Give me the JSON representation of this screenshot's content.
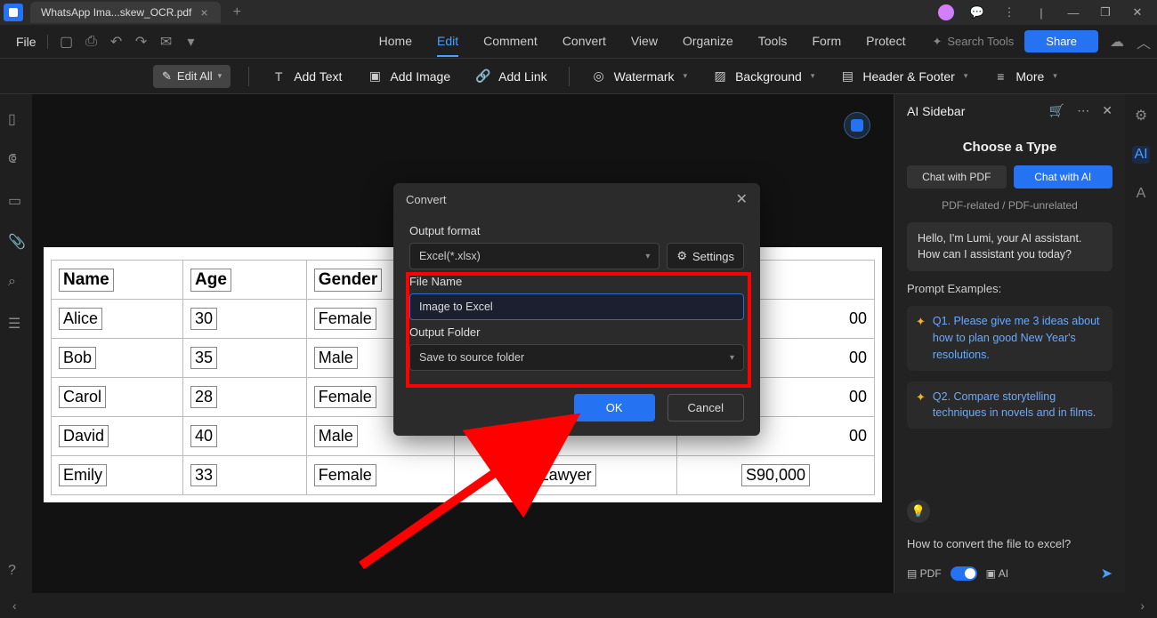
{
  "titlebar": {
    "tab_title": "WhatsApp Ima...skew_OCR.pdf"
  },
  "menubar": {
    "file": "File",
    "tabs": [
      "Home",
      "Edit",
      "Comment",
      "Convert",
      "View",
      "Organize",
      "Tools",
      "Form",
      "Protect"
    ],
    "active_tab_index": 1,
    "search_placeholder": "Search Tools",
    "share": "Share"
  },
  "toolbar": {
    "edit_all": "Edit All",
    "add_text": "Add Text",
    "add_image": "Add Image",
    "add_link": "Add Link",
    "watermark": "Watermark",
    "background": "Background",
    "header_footer": "Header & Footer",
    "more": "More"
  },
  "document": {
    "headers": [
      "Name",
      "Age",
      "Gender",
      "",
      ""
    ],
    "rows": [
      [
        "Alice",
        "30",
        "Female",
        "",
        "00"
      ],
      [
        "Bob",
        "35",
        "Male",
        "",
        "00"
      ],
      [
        "Carol",
        "28",
        "Female",
        "",
        "00"
      ],
      [
        "David",
        "40",
        "Male",
        "",
        "00"
      ],
      [
        "Emily",
        "33",
        "Female",
        "Lawyer",
        "S90,000"
      ]
    ]
  },
  "dialog": {
    "title": "Convert",
    "output_format_label": "Output format",
    "output_format_value": "Excel(*.xlsx)",
    "settings": "Settings",
    "file_name_label": "File Name",
    "file_name_value": "Image to Excel",
    "output_folder_label": "Output Folder",
    "output_folder_value": "Save to source folder",
    "ok": "OK",
    "cancel": "Cancel"
  },
  "ai": {
    "title": "AI Sidebar",
    "choose": "Choose a Type",
    "tab_pdf": "Chat with PDF",
    "tab_ai": "Chat with AI",
    "sub": "PDF-related / PDF-unrelated",
    "greeting": "Hello, I'm Lumi, your AI assistant. How can I assistant you today?",
    "examples_head": "Prompt Examples:",
    "ex1": "Q1. Please give me 3 ideas about how to plan good New Year's resolutions.",
    "ex2": "Q2. Compare storytelling techniques in novels and in films.",
    "prompt": "How to convert the file to excel?",
    "footer_pdf": "PDF",
    "footer_ai": "AI"
  }
}
